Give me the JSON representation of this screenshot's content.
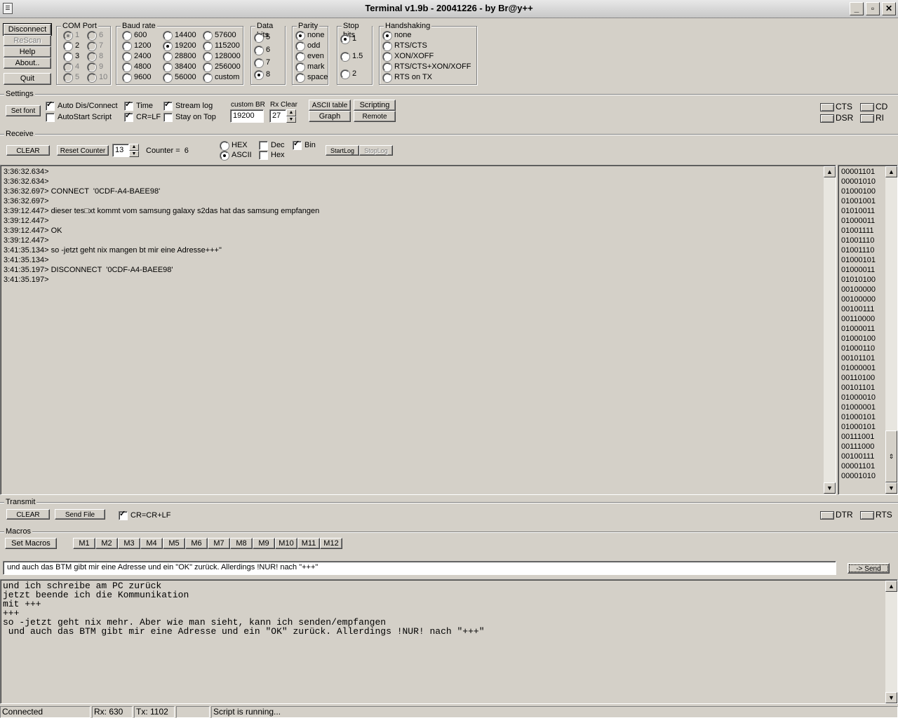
{
  "window": {
    "title": "Terminal v1.9b - 20041226 - by Br@y++",
    "min": "_",
    "max": "▫",
    "close": "✕"
  },
  "left_buttons": {
    "disconnect": "Disconnect",
    "rescan": "ReScan",
    "help": "Help",
    "about": "About..",
    "quit": "Quit"
  },
  "com_port": {
    "label": "COM Port",
    "options": [
      "1",
      "2",
      "3",
      "4",
      "5",
      "6",
      "7",
      "8",
      "9",
      "10"
    ],
    "selected": "1"
  },
  "baud_rate": {
    "label": "Baud rate",
    "options": [
      "600",
      "1200",
      "2400",
      "4800",
      "9600",
      "14400",
      "19200",
      "28800",
      "38400",
      "56000",
      "57600",
      "115200",
      "128000",
      "256000",
      "custom"
    ],
    "selected": "19200"
  },
  "data_bits": {
    "label": "Data bits",
    "options": [
      "5",
      "6",
      "7",
      "8"
    ],
    "selected": "8"
  },
  "parity": {
    "label": "Parity",
    "options": [
      "none",
      "odd",
      "even",
      "mark",
      "space"
    ],
    "selected": "none"
  },
  "stop_bits": {
    "label": "Stop bits",
    "options": [
      "1",
      "1.5",
      "2"
    ],
    "selected": "1"
  },
  "handshaking": {
    "label": "Handshaking",
    "options": [
      "none",
      "RTS/CTS",
      "XON/XOFF",
      "RTS/CTS+XON/XOFF",
      "RTS on TX"
    ],
    "selected": "none"
  },
  "settings": {
    "label": "Settings",
    "set_font": "Set font",
    "auto_dis_connect": "Auto Dis/Connect",
    "autostart_script": "AutoStart Script",
    "time": "Time",
    "cr_lf": "CR=LF",
    "stream_log": "Stream log",
    "stay_on_top": "Stay on Top",
    "custom_br_label": "custom BR",
    "custom_br_value": "19200",
    "rx_clear_label": "Rx Clear",
    "rx_clear_value": "27",
    "ascii_table": "ASCII table",
    "graph": "Graph",
    "scripting": "Scripting",
    "remote": "Remote",
    "cts": "CTS",
    "cd": "CD",
    "dsr": "DSR",
    "ri": "RI"
  },
  "receive": {
    "label": "Receive",
    "clear": "CLEAR",
    "reset_counter": "Reset Counter",
    "counter_value": "13",
    "counter_text": "Counter =  6",
    "hex": "HEX",
    "ascii": "ASCII",
    "dec": "Dec",
    "hex_small": "Hex",
    "bin": "Bin",
    "startlog": "StartLog",
    "stoplog": "StopLog",
    "lines": [
      "3:36:32.634>",
      "3:36:32.634>",
      "3:36:32.697> CONNECT  '0CDF-A4-BAEE98'",
      "3:36:32.697>",
      "3:39:12.447> dieser tes□xt kommt vom samsung galaxy s2das hat das samsung empfangen",
      "3:39:12.447>",
      "3:39:12.447> OK",
      "3:39:12.447>",
      "3:41:35.134> so -jetzt geht nix mangen bt mir eine Adresse+++\"",
      "3:41:35.134>",
      "3:41:35.197> DISCONNECT  '0CDF-A4-BAEE98'",
      "3:41:35.197>"
    ],
    "bin_lines": [
      "00001101",
      "00001010",
      "01000100",
      "01001001",
      "01010011",
      "01000011",
      "01001111",
      "01001110",
      "01001110",
      "01000101",
      "01000011",
      "01010100",
      "00100000",
      "00100000",
      "00100111",
      "00110000",
      "01000011",
      "01000100",
      "01000110",
      "00101101",
      "01000001",
      "00110100",
      "00101101",
      "01000010",
      "01000001",
      "01000101",
      "01000101",
      "00111001",
      "00111000",
      "00100111",
      "00001101",
      "00001010"
    ]
  },
  "transmit": {
    "label": "Transmit",
    "clear": "CLEAR",
    "send_file": "Send File",
    "cr_crlf": "CR=CR+LF",
    "dtr": "DTR",
    "rts": "RTS"
  },
  "macros": {
    "label": "Macros",
    "set_macros": "Set Macros",
    "buttons": [
      "M1",
      "M2",
      "M3",
      "M4",
      "M5",
      "M6",
      "M7",
      "M8",
      "M9",
      "M10",
      "M11",
      "M12"
    ]
  },
  "send": {
    "input_value": "und auch das BTM gibt mir eine Adresse und ein \"OK\" zurück. Allerdings !NUR! nach \"+++\"",
    "button": "-> Send"
  },
  "transmit_log": [
    "und ich schreibe am PC zurück",
    "jetzt beende ich die Kommunikation",
    "mit +++",
    "+++",
    "so -jetzt geht nix mehr. Aber wie man sieht, kann ich senden/empfangen",
    " und auch das BTM gibt mir eine Adresse und ein \"OK\" zurück. Allerdings !NUR! nach \"+++\""
  ],
  "status": {
    "connection": "Connected",
    "rx": "Rx: 630",
    "tx": "Tx: 1102",
    "script": "Script is running..."
  }
}
